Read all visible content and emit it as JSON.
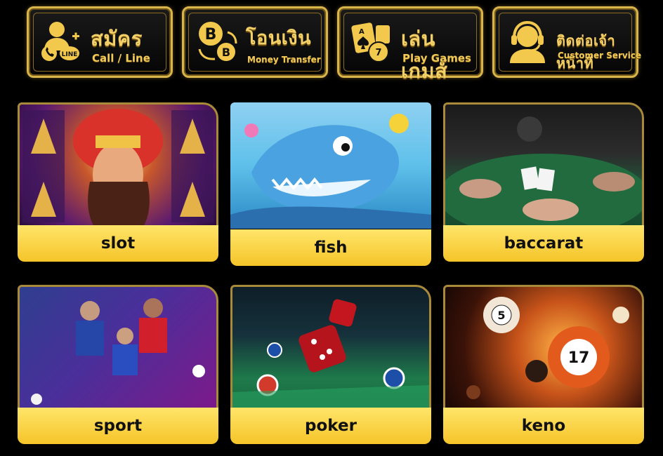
{
  "top_buttons": [
    {
      "thai": "สมัคร",
      "english": "Call / Line",
      "icon": "user-phone-line-icon"
    },
    {
      "thai": "โอนเงิน",
      "english": "Money Transfer",
      "icon": "bitcoin-transfer-icon"
    },
    {
      "thai": "เล่นเกมส์",
      "english": "Play Games",
      "icon": "cards-chip-icon"
    },
    {
      "thai": "ติดต่อเจ้าหน้าที่",
      "english": "Customer Service",
      "icon": "headset-agent-icon"
    }
  ],
  "games": [
    {
      "label": "slot"
    },
    {
      "label": "fish"
    },
    {
      "label": "baccarat"
    },
    {
      "label": "sport"
    },
    {
      "label": "poker"
    },
    {
      "label": "keno"
    }
  ],
  "colors": {
    "gold": "#f5c429",
    "gold_border": "#d9b44a",
    "background": "#000000"
  }
}
